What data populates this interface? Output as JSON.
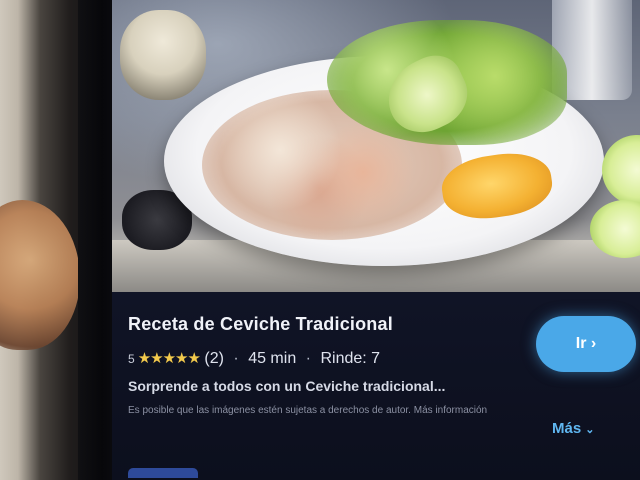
{
  "recipe_card": {
    "title": "Receta de Ceviche Tradicional",
    "rating_prefix": "5",
    "stars": "★★★★★",
    "review_count": "(2)",
    "time": "45 min",
    "servings": "Rinde: 7",
    "separator": "·",
    "description": "Sorprende a todos con un Ceviche tradicional...",
    "disclaimer": "Es posible que las imágenes estén sujetas a derechos de autor. Más información",
    "go_button_label": "Ir ›",
    "more_label": "Más",
    "more_chevron": "⌄"
  },
  "colors": {
    "accent": "#4aa8e8",
    "star": "#f2c94c",
    "card_background": "#101426"
  },
  "icons": {
    "rating": "star-icon",
    "more": "chevron-down-icon"
  }
}
